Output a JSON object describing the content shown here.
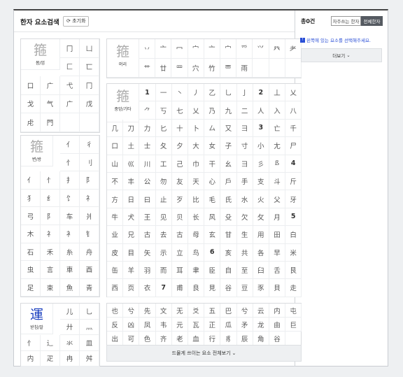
{
  "header": {
    "title": "한자 요소검색",
    "reset_label": "초기화",
    "reset_icon": "refresh-icon"
  },
  "right": {
    "count_label": "총0건",
    "toggle_frequent": "자주쓰는 한자",
    "toggle_all": "전체한자",
    "info_text": "왼쪽에 있는 요소를 선택해주세요.",
    "info_icon": "info-icon",
    "more_label": "더보기"
  },
  "panels": {
    "outer": {
      "label": "몸/엄",
      "char": "箍",
      "chars": [
        "冂",
        "凵",
        "匚",
        "匸",
        "口",
        "广",
        "弋",
        "冂",
        "戈",
        "气",
        "广",
        "戊",
        "虍",
        "門",
        "",
        ""
      ]
    },
    "top": {
      "label": "머리",
      "char": "箍",
      "chars": [
        "丷",
        "亠",
        "冖",
        "宀",
        "亠",
        "宀",
        "爫",
        "⺍",
        "癶",
        "耂",
        "艹",
        "廿",
        "罒",
        "穴",
        "竹",
        "覀",
        "雨",
        "",
        "",
        ""
      ]
    },
    "left": {
      "label": "변/방",
      "char": "箍",
      "chars": [
        "亻",
        "彳",
        "忄",
        "刂",
        "亻",
        "忄",
        "扌",
        "阝",
        "犭",
        "纟",
        "饣",
        "礻",
        "弓",
        "阝",
        "车",
        "爿",
        "木",
        "礻",
        "衤",
        "钅",
        "石",
        "禾",
        "糸",
        "舟",
        "虫",
        "言",
        "車",
        "酉",
        "足",
        "束",
        "魚",
        "青",
        "金",
        "食",
        "骨",
        "魚"
      ]
    },
    "middle": {
      "label": "중앙/기타",
      "char": "箍",
      "chars": [
        "1",
        "一",
        "丶",
        "丿",
        "乙",
        "乚",
        "亅",
        "2",
        "丄",
        "乂",
        "⺈",
        "丂",
        "七",
        "乂",
        "乃",
        "九",
        "二",
        "人",
        "入",
        "八",
        "几",
        "刀",
        "力",
        "匕",
        "十",
        "卜",
        "厶",
        "又",
        "彐",
        "3",
        "亡",
        "千",
        "口",
        "土",
        "士",
        "夂",
        "夕",
        "大",
        "女",
        "子",
        "寸",
        "小",
        "尢",
        "尸",
        "山",
        "巛",
        "川",
        "工",
        "己",
        "巾",
        "干",
        "幺",
        "彐",
        "彡",
        "ß",
        "4",
        "不",
        "丰",
        "公",
        "勿",
        "友",
        "天",
        "心",
        "戶",
        "手",
        "支",
        "斗",
        "斤",
        "方",
        "日",
        "曰",
        "止",
        "歹",
        "比",
        "毛",
        "氏",
        "水",
        "火",
        "父",
        "牙",
        "牛",
        "犬",
        "王",
        "见",
        "贝",
        "长",
        "风",
        "殳",
        "欠",
        "攵",
        "月",
        "5",
        "业",
        "兄",
        "古",
        "去",
        "古",
        "母",
        "玄",
        "甘",
        "生",
        "用",
        "田",
        "白",
        "皮",
        "目",
        "矢",
        "示",
        "立",
        "鸟",
        "6",
        "亥",
        "共",
        "各",
        "早",
        "米",
        "缶",
        "羊",
        "羽",
        "而",
        "耳",
        "聿",
        "臣",
        "自",
        "至",
        "臼",
        "舌",
        "艮",
        "西",
        "页",
        "衣",
        "7",
        "甫",
        "良",
        "見",
        "谷",
        "豆",
        "豕",
        "貝",
        "走",
        "辛",
        "釆",
        "里",
        "身",
        "8+",
        "隹",
        "者",
        "音",
        "頁",
        "馬"
      ]
    },
    "bottom_left": {
      "label": "받침/발",
      "char": "運",
      "chars": [
        "儿",
        "乚",
        "廾",
        "灬",
        "忄",
        "辶",
        "氺",
        "皿",
        "内",
        "疋",
        "冉",
        "舛"
      ]
    },
    "bottom_mid": {
      "chars": [
        "也",
        "兮",
        "先",
        "文",
        "无",
        "爻",
        "五",
        "巴",
        "兮",
        "云",
        "内",
        "屯",
        "反",
        "凶",
        "凤",
        "韦",
        "元",
        "瓦",
        "正",
        "瓜",
        "矛",
        "龙",
        "由",
        "巨",
        "出",
        "可",
        "色",
        "齐",
        "老",
        "血",
        "行",
        "豸",
        "辰",
        "角",
        "谷"
      ]
    }
  },
  "bottom_more_label": "드물게 쓰이는 요소 전체보기",
  "colors": {
    "accent": "#1a3fbf",
    "toggle_active": "#555a61"
  }
}
